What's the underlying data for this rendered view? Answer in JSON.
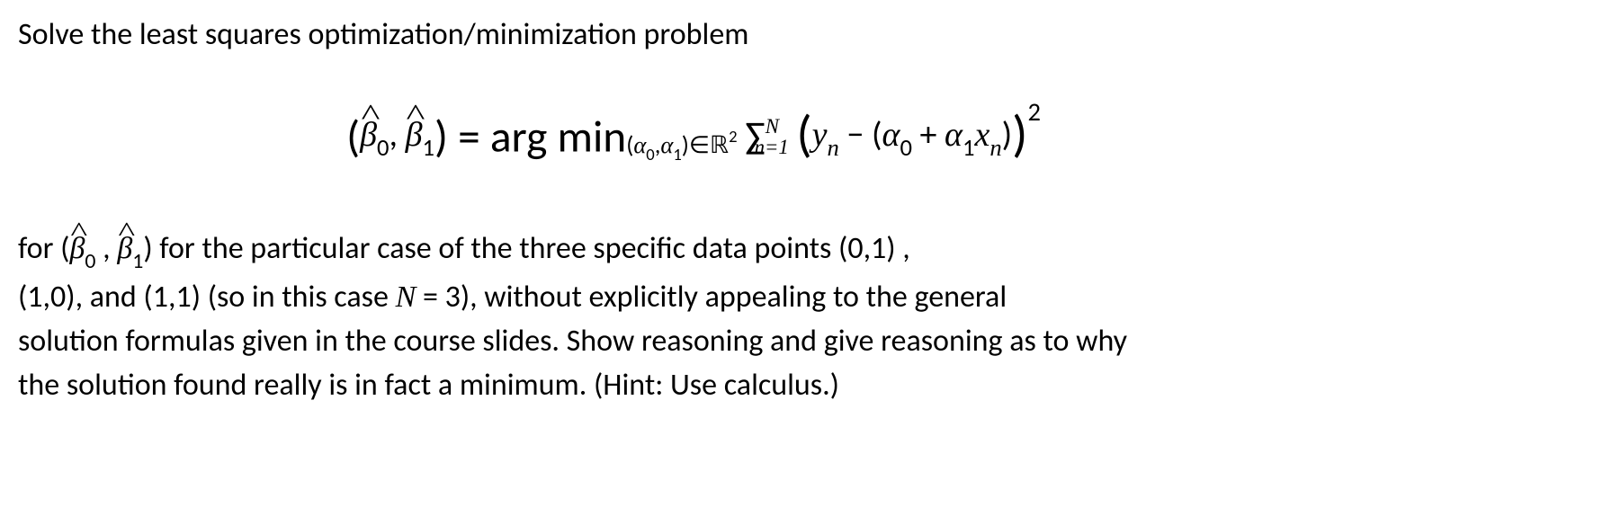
{
  "line1": "Solve the least squares optimization/minimization problem",
  "equation": {
    "lhs_open": "(",
    "beta0": "β",
    "beta0_sub": "0",
    "comma1": ", ",
    "beta1": "β",
    "beta1_sub": "1",
    "lhs_close": ") = arg min",
    "argmin_sub_open": "(",
    "alpha0": "α",
    "alpha0_sub": "0",
    "argmin_comma": ",",
    "alpha1": "α",
    "alpha1_sub": "1",
    "argmin_close": ")∈",
    "real": "ℝ",
    "real_sup": "2",
    "sum_symbol": "∑",
    "sum_upper": "N",
    "sum_lower": "n=1",
    "term_open": "(",
    "yn": "y",
    "yn_sub": "n",
    "minus": " − (",
    "a0": "α",
    "a0_sub": "0",
    "plus": " + ",
    "a1": "α",
    "a1_sub": "1",
    "xn": "x",
    "xn_sub": "n",
    "inner_close": ")",
    "term_close": ")",
    "squared": "2"
  },
  "para": {
    "p1_a": "for (",
    "p1_beta0": "β",
    "p1_beta0_sub": "0",
    "p1_comma": " , ",
    "p1_beta1": "β",
    "p1_beta1_sub": "1",
    "p1_b": ") for the particular case of the three specific data points (0,1) ,",
    "p2_a": "(1,0), and (1,1)  (so in this case ",
    "p2_N": "N",
    "p2_b": " = 3), without explicitly appealing to the general",
    "p3": "solution formulas given in the course slides. Show reasoning and give reasoning as to why",
    "p4": "the solution found really is in fact a minimum. (Hint: Use calculus.)"
  }
}
